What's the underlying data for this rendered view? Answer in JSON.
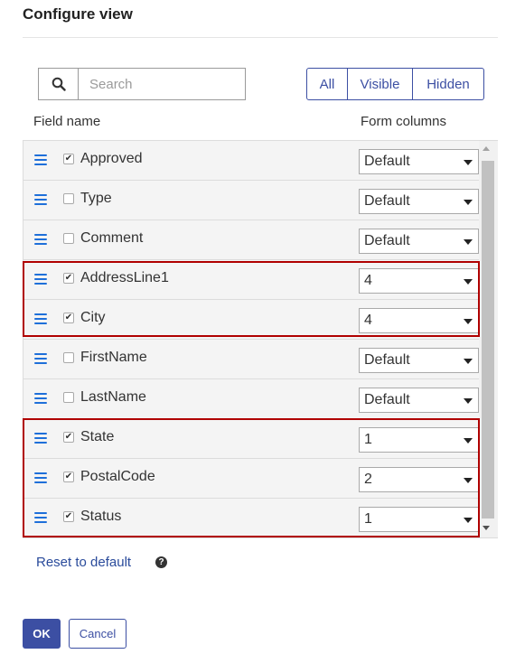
{
  "dialog": {
    "title": "Configure view"
  },
  "search": {
    "placeholder": "Search",
    "value": ""
  },
  "filter_tabs": [
    {
      "label": "All",
      "active": true
    },
    {
      "label": "Visible",
      "active": false
    },
    {
      "label": "Hidden",
      "active": false
    }
  ],
  "columns": {
    "field_name": "Field name",
    "form_columns": "Form columns"
  },
  "fields": [
    {
      "name": "Approved",
      "checked": true,
      "form_columns": "Default",
      "highlighted": false
    },
    {
      "name": "Type",
      "checked": false,
      "form_columns": "Default",
      "highlighted": false
    },
    {
      "name": "Comment",
      "checked": false,
      "form_columns": "Default",
      "highlighted": false
    },
    {
      "name": "AddressLine1",
      "checked": true,
      "form_columns": "4",
      "highlighted": true
    },
    {
      "name": "City",
      "checked": true,
      "form_columns": "4",
      "highlighted": true
    },
    {
      "name": "FirstName",
      "checked": false,
      "form_columns": "Default",
      "highlighted": false
    },
    {
      "name": "LastName",
      "checked": false,
      "form_columns": "Default",
      "highlighted": false
    },
    {
      "name": "State",
      "checked": true,
      "form_columns": "1",
      "highlighted": true
    },
    {
      "name": "PostalCode",
      "checked": true,
      "form_columns": "2",
      "highlighted": true
    },
    {
      "name": "Status",
      "checked": true,
      "form_columns": "1",
      "highlighted": true
    }
  ],
  "icons": {
    "search": "search-icon",
    "drag_handle": "hamburger-drag-icon",
    "help": "help-icon",
    "dropdown": "chevron-down-icon"
  },
  "footer": {
    "reset_label": "Reset to default",
    "help_glyph": "?",
    "ok_label": "OK",
    "cancel_label": "Cancel"
  },
  "colors": {
    "primary": "#3c4fa3",
    "drag_handle": "#1e6fd9",
    "highlight_border": "#b00000",
    "row_background": "#f4f4f4"
  }
}
